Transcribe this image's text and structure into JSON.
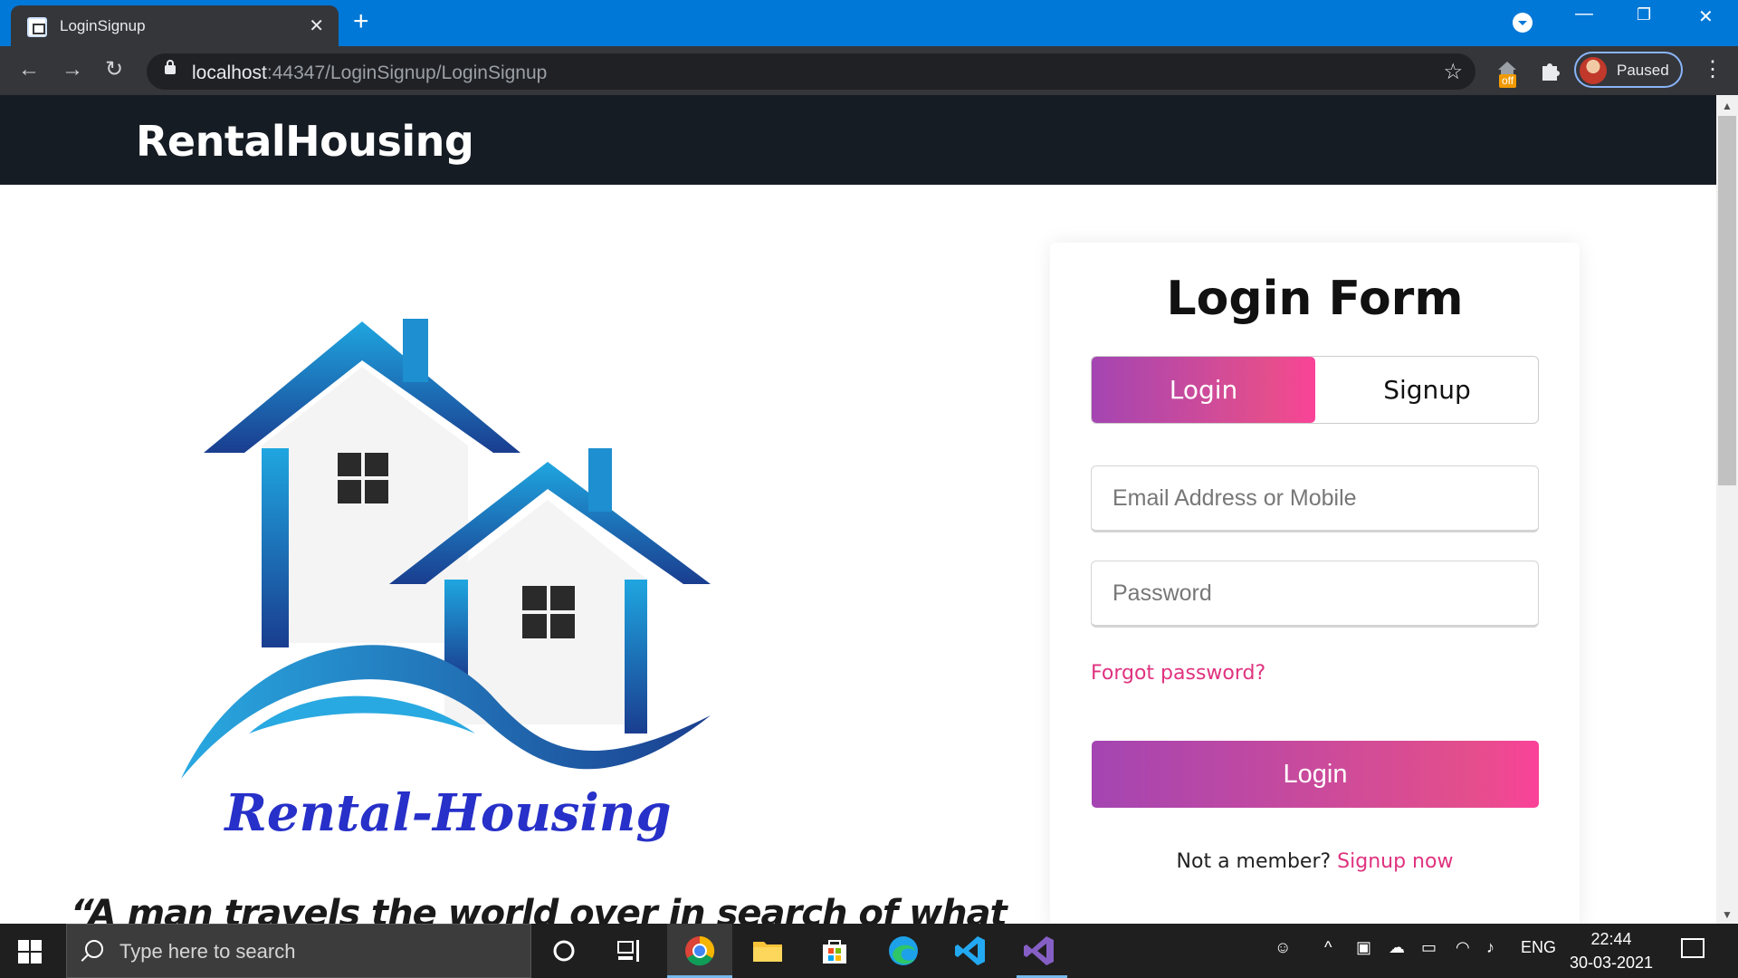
{
  "browser": {
    "tab_title": "LoginSignup",
    "url_host": "localhost",
    "url_rest": ":44347/LoginSignup/LoginSignup",
    "profile_label": "Paused",
    "ext_badge": "off"
  },
  "site": {
    "brand": "RentalHousing",
    "logo_text": "Rental-Housing",
    "quote": "“A man travels the world over in search of what"
  },
  "form": {
    "title": "Login Form",
    "tab_login": "Login",
    "tab_signup": "Signup",
    "email_placeholder": "Email Address or Mobile",
    "password_placeholder": "Password",
    "forgot": "Forgot password?",
    "submit": "Login",
    "not_member": "Not a member?",
    "signup_link": "Signup now"
  },
  "taskbar": {
    "search_placeholder": "Type here to search",
    "lang": "ENG",
    "time": "22:44",
    "date": "30-03-2021"
  },
  "colors": {
    "accent_start": "#a445b2",
    "accent_end": "#fa4299",
    "header_bg": "#161c24",
    "titlebar": "#0078d7"
  }
}
